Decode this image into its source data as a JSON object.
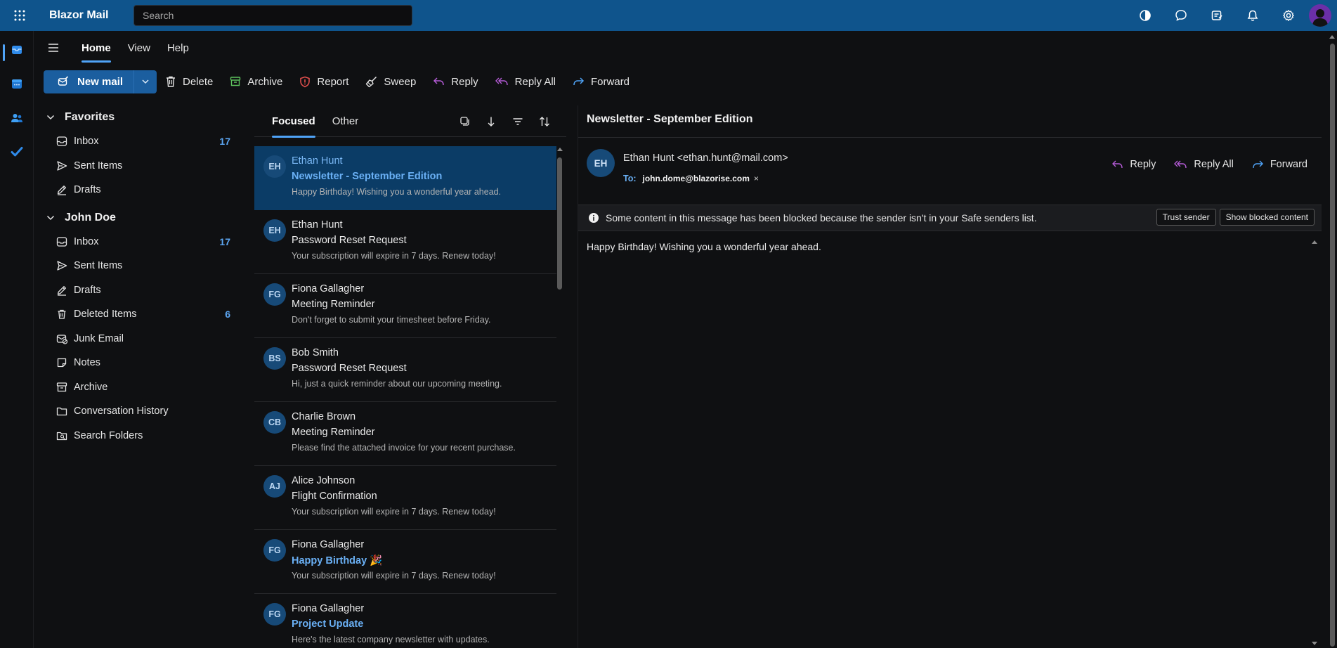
{
  "app": {
    "title": "Blazor Mail",
    "search_placeholder": "Search"
  },
  "top_icons": [
    "contrast-icon",
    "chat-icon",
    "notes-icon",
    "bell-icon",
    "gear-icon",
    "profile-avatar"
  ],
  "rail": [
    "mail-icon",
    "calendar-icon",
    "people-icon",
    "todo-check-icon"
  ],
  "ribbon": {
    "tabs": [
      {
        "label": "Home",
        "active": true
      },
      {
        "label": "View",
        "active": false
      },
      {
        "label": "Help",
        "active": false
      }
    ]
  },
  "toolbar": {
    "new_mail": "New mail",
    "delete": "Delete",
    "archive": "Archive",
    "report": "Report",
    "sweep": "Sweep",
    "reply": "Reply",
    "reply_all": "Reply All",
    "forward": "Forward"
  },
  "folders": {
    "favorites": {
      "title": "Favorites",
      "items": [
        {
          "label": "Inbox",
          "count": "17"
        },
        {
          "label": "Sent Items",
          "count": ""
        },
        {
          "label": "Drafts",
          "count": ""
        }
      ]
    },
    "account": {
      "title": "John Doe",
      "items": [
        {
          "label": "Inbox",
          "count": "17"
        },
        {
          "label": "Sent Items",
          "count": ""
        },
        {
          "label": "Drafts",
          "count": ""
        },
        {
          "label": "Deleted Items",
          "count": "6"
        },
        {
          "label": "Junk Email",
          "count": ""
        },
        {
          "label": "Notes",
          "count": ""
        },
        {
          "label": "Archive",
          "count": ""
        },
        {
          "label": "Conversation History",
          "count": ""
        },
        {
          "label": "Search Folders",
          "count": ""
        }
      ]
    }
  },
  "list": {
    "tabs": [
      {
        "label": "Focused",
        "active": true
      },
      {
        "label": "Other",
        "active": false
      }
    ],
    "messages": [
      {
        "initials": "EH",
        "from": "Ethan Hunt",
        "subject": "Newsletter - September Edition",
        "preview": "Happy Birthday! Wishing you a wonderful year ahead.",
        "unread": true,
        "selected": true
      },
      {
        "initials": "EH",
        "from": "Ethan Hunt",
        "subject": "Password Reset Request",
        "preview": "Your subscription will expire in 7 days. Renew today!",
        "unread": false,
        "selected": false
      },
      {
        "initials": "FG",
        "from": "Fiona Gallagher",
        "subject": "Meeting Reminder",
        "preview": "Don't forget to submit your timesheet before Friday.",
        "unread": false,
        "selected": false
      },
      {
        "initials": "BS",
        "from": "Bob Smith",
        "subject": "Password Reset Request",
        "preview": "Hi, just a quick reminder about our upcoming meeting.",
        "unread": false,
        "selected": false
      },
      {
        "initials": "CB",
        "from": "Charlie Brown",
        "subject": "Meeting Reminder",
        "preview": "Please find the attached invoice for your recent purchase.",
        "unread": false,
        "selected": false
      },
      {
        "initials": "AJ",
        "from": "Alice Johnson",
        "subject": "Flight Confirmation",
        "preview": "Your subscription will expire in 7 days. Renew today!",
        "unread": false,
        "selected": false
      },
      {
        "initials": "FG",
        "from": "Fiona Gallagher",
        "subject": "Happy Birthday 🎉",
        "preview": "Your subscription will expire in 7 days. Renew today!",
        "unread": true,
        "selected": false
      },
      {
        "initials": "FG",
        "from": "Fiona Gallagher",
        "subject": "Project Update",
        "preview": "Here's the latest company newsletter with updates.",
        "unread": true,
        "selected": false
      }
    ]
  },
  "reading": {
    "subject": "Newsletter - September Edition",
    "initials": "EH",
    "from": "Ethan Hunt <ethan.hunt@mail.com>",
    "to_label": "To:",
    "to": "john.dome@blazorise.com",
    "to_remove": "×",
    "actions": {
      "reply": "Reply",
      "reply_all": "Reply All",
      "forward": "Forward"
    },
    "blocked_notice": "Some content in this message has been blocked because the sender isn't in your Safe senders list.",
    "trust_sender": "Trust sender",
    "show_blocked": "Show blocked content",
    "body": "Happy Birthday! Wishing you a wonderful year ahead."
  },
  "colors": {
    "topbar": "#0f548c",
    "accent": "#4fa3f7",
    "unread": "#6ab0f5",
    "selected_row": "#0b3c66",
    "background": "#0f1012"
  }
}
